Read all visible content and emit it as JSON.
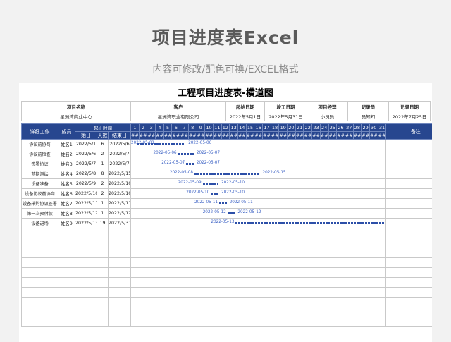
{
  "hero": {
    "title": "项目进度表Excel",
    "subtitle": "内容可修改/配色可换/EXCEL格式"
  },
  "sheet_title": "工程项目进度表-横道图",
  "info": {
    "headers": [
      "项目名称",
      "客户",
      "起始日期",
      "竣工日期",
      "项目经理",
      "记录员",
      "记录日期"
    ],
    "values": [
      "星洲湾商业中心",
      "星洲湾职业有限公司",
      "2022年5月1日",
      "2022年5月31日",
      "小员员",
      "员知知",
      "2022年7月25日"
    ]
  },
  "table": {
    "col_task": "详细工作",
    "col_member": "成员",
    "col_range": "起止时间",
    "col_start": "始日",
    "col_days": "天数",
    "col_end": "结束日",
    "col_note": "备注",
    "hash": "##",
    "days": [
      "1",
      "2",
      "3",
      "4",
      "5",
      "6",
      "7",
      "8",
      "9",
      "10",
      "11",
      "12",
      "13",
      "14",
      "15",
      "16",
      "17",
      "18",
      "19",
      "20",
      "21",
      "22",
      "23",
      "24",
      "25",
      "26",
      "27",
      "28",
      "29",
      "30",
      "31"
    ],
    "rows": [
      {
        "task": "协议前协商",
        "member": "姓名1",
        "start": "2022/5/1",
        "days": "6",
        "end": "2022/5/6",
        "sd": 1,
        "ed": 6,
        "start_label": "2022-05-01",
        "end_label": "2022-05-06"
      },
      {
        "task": "协议前检查",
        "member": "姓名2",
        "start": "2022/5/6",
        "days": "2",
        "end": "2022/5/7",
        "sd": 6,
        "ed": 7,
        "start_label": "2022-05-06",
        "end_label": "2022-05-07"
      },
      {
        "task": "签署协议",
        "member": "姓名3",
        "start": "2022/5/7",
        "days": "1",
        "end": "2022/5/7",
        "sd": 7,
        "ed": 7,
        "start_label": "2022-05-07",
        "end_label": "2022-05-07"
      },
      {
        "task": "前期测绘",
        "member": "姓名4",
        "start": "2022/5/8",
        "days": "8",
        "end": "2022/5/15",
        "sd": 8,
        "ed": 15,
        "start_label": "2022-05-08",
        "end_label": "2022-05-15"
      },
      {
        "task": "设备准备",
        "member": "姓名5",
        "start": "2022/5/9",
        "days": "2",
        "end": "2022/5/10",
        "sd": 9,
        "ed": 10,
        "start_label": "2022-05-09",
        "end_label": "2022-05-10"
      },
      {
        "task": "设备协议前协商",
        "member": "姓名6",
        "start": "2022/5/10",
        "days": "2",
        "end": "2022/5/10",
        "sd": 10,
        "ed": 10,
        "start_label": "2022-05-10",
        "end_label": "2022-05-10"
      },
      {
        "task": "设备采购协议签署",
        "member": "姓名7",
        "start": "2022/5/11",
        "days": "1",
        "end": "2022/5/11",
        "sd": 11,
        "ed": 11,
        "start_label": "2022-05-11",
        "end_label": "2022-05-11"
      },
      {
        "task": "第一次预付款",
        "member": "姓名8",
        "start": "2022/5/12",
        "days": "1",
        "end": "2022/5/12",
        "sd": 12,
        "ed": 12,
        "start_label": "2022-05-12",
        "end_label": "2022-05-12"
      },
      {
        "task": "设备进场",
        "member": "姓名9",
        "start": "2022/5/13",
        "days": "19",
        "end": "2022/5/31",
        "sd": 13,
        "ed": 31,
        "start_label": "2022-05-13",
        "end_label": "2022-05-31"
      }
    ],
    "empty_rows": 10
  },
  "colors": {
    "header_bg": "#27468f",
    "bar": "#2c4fa8",
    "label": "#3b61c4"
  }
}
